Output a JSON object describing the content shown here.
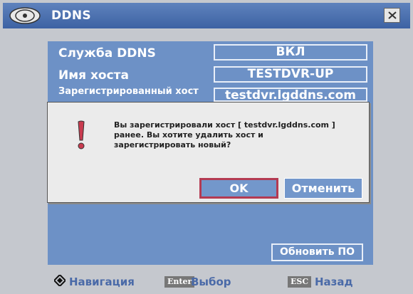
{
  "window": {
    "title": "DDNS",
    "icons": {
      "logo": "lg-logo-icon",
      "close": "close-icon"
    }
  },
  "form": {
    "rows": [
      {
        "label": "Служба DDNS",
        "value": "ВКЛ"
      },
      {
        "label": "Имя хоста",
        "value": "TESTDVR-UP"
      },
      {
        "label": "Зарегистрированный хост",
        "value": "testdvr.lgddns.com"
      }
    ],
    "update_button": "Обновить ПО"
  },
  "dialog": {
    "icon": "warning-icon",
    "message": "Вы зарегистрировали хост [ testdvr.lgddns.com ] ранее. Вы хотите удалить хост и зарегистрировать новый?",
    "ok_label": "OK",
    "cancel_label": "Отменить"
  },
  "footer": {
    "nav_icon": "navigation-arrows-icon",
    "nav_label": "Навигация",
    "enter_key": "Enter",
    "enter_label": "Выбор",
    "esc_key": "ESC",
    "esc_label": "Назад"
  },
  "colors": {
    "titlebar": "#4a6eae",
    "panel": "#6d91c6",
    "window_bg": "#c5c8ce",
    "dialog_bg": "#ebebeb",
    "ok_border": "#b43a52",
    "footer_text": "#4a6aa8"
  }
}
